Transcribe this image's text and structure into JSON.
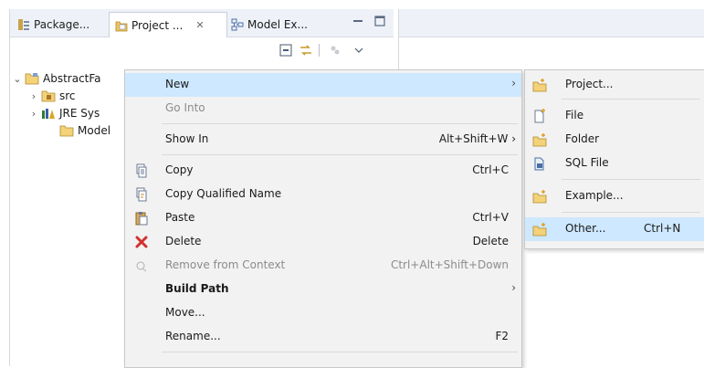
{
  "tabs": [
    {
      "label": "Package..."
    },
    {
      "label": "Project ...",
      "close": "✕"
    },
    {
      "label": "Model Ex..."
    }
  ],
  "tree": {
    "root": "AbstractFa",
    "children": [
      "src",
      "JRE Sys",
      "Model"
    ]
  },
  "context_menu": {
    "new": {
      "label": "New",
      "arrow": "›"
    },
    "go_into": {
      "label": "Go Into"
    },
    "show_in": {
      "label": "Show In",
      "accel": "Alt+Shift+W ›"
    },
    "copy": {
      "label": "Copy",
      "accel": "Ctrl+C"
    },
    "copy_qualified": {
      "label": "Copy Qualified Name"
    },
    "paste": {
      "label": "Paste",
      "accel": "Ctrl+V"
    },
    "delete": {
      "label": "Delete",
      "accel": "Delete"
    },
    "remove_context": {
      "label": "Remove from Context",
      "accel": "Ctrl+Alt+Shift+Down"
    },
    "build_path": {
      "label": "Build Path",
      "arrow": "›"
    },
    "move": {
      "label": "Move..."
    },
    "rename": {
      "label": "Rename...",
      "accel": "F2"
    }
  },
  "submenu": {
    "project": {
      "label": "Project..."
    },
    "file": {
      "label": "File"
    },
    "folder": {
      "label": "Folder"
    },
    "sql_file": {
      "label": "SQL File"
    },
    "example": {
      "label": "Example..."
    },
    "other": {
      "label": "Other...",
      "accel": "Ctrl+N"
    }
  },
  "colors": {
    "highlight": "#cde8ff",
    "menu_bg": "#f2f2f2",
    "tab_bar": "#eef2f8"
  }
}
